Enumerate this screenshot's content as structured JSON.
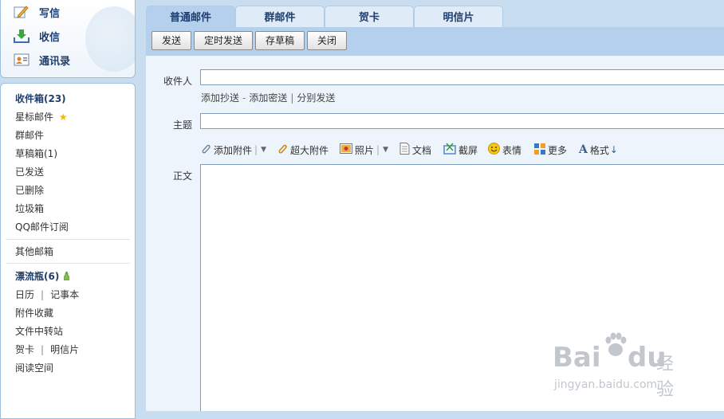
{
  "quick_actions": [
    {
      "label": "写信",
      "icon": "write-letter-icon"
    },
    {
      "label": "收信",
      "icon": "receive-mail-icon"
    },
    {
      "label": "通讯录",
      "icon": "address-book-icon"
    }
  ],
  "folders": {
    "inbox": "收件箱(23)",
    "starred": "星标邮件",
    "group_mail": "群邮件",
    "drafts": "草稿箱(1)",
    "sent": "已发送",
    "deleted": "已删除",
    "trash": "垃圾箱",
    "subscription": "QQ邮件订阅",
    "other_mailbox": "其他邮箱",
    "drift_bottle": "漂流瓶(6)",
    "calendar": "日历",
    "notepad": "记事本",
    "attachment_collection": "附件收藏",
    "file_transfer": "文件中转站",
    "greeting_card": "贺卡",
    "postcard": "明信片",
    "reading_space": "阅读空间"
  },
  "tabs": [
    "普通邮件",
    "群邮件",
    "贺卡",
    "明信片"
  ],
  "toolbar": {
    "send": "发送",
    "scheduled_send": "定时发送",
    "save_draft": "存草稿",
    "close": "关闭"
  },
  "compose": {
    "recipient_label": "收件人",
    "recipient_value": "",
    "add_cc": "添加抄送",
    "dash": "-",
    "add_bcc": "添加密送",
    "divider": "|",
    "separate_send": "分别发送",
    "subject_label": "主题",
    "subject_value": "",
    "body_label": "正文"
  },
  "attachments": {
    "add_attachment": "添加附件",
    "large_attachment": "超大附件",
    "photo": "照片",
    "document": "文档",
    "screenshot": "截屏",
    "emoticon": "表情",
    "more": "更多",
    "format": "格式"
  },
  "watermark": {
    "brand": "Bai",
    "brand_suffix": "du",
    "cn": "经验",
    "url": "jingyan.baidu.com"
  },
  "colors": {
    "accent": "#1e3f6e",
    "tab_active": "#b5d0ec",
    "tab_inactive": "#dfebf7",
    "compose_bg": "#eef4fb",
    "page_bg": "#c9ddf0"
  }
}
